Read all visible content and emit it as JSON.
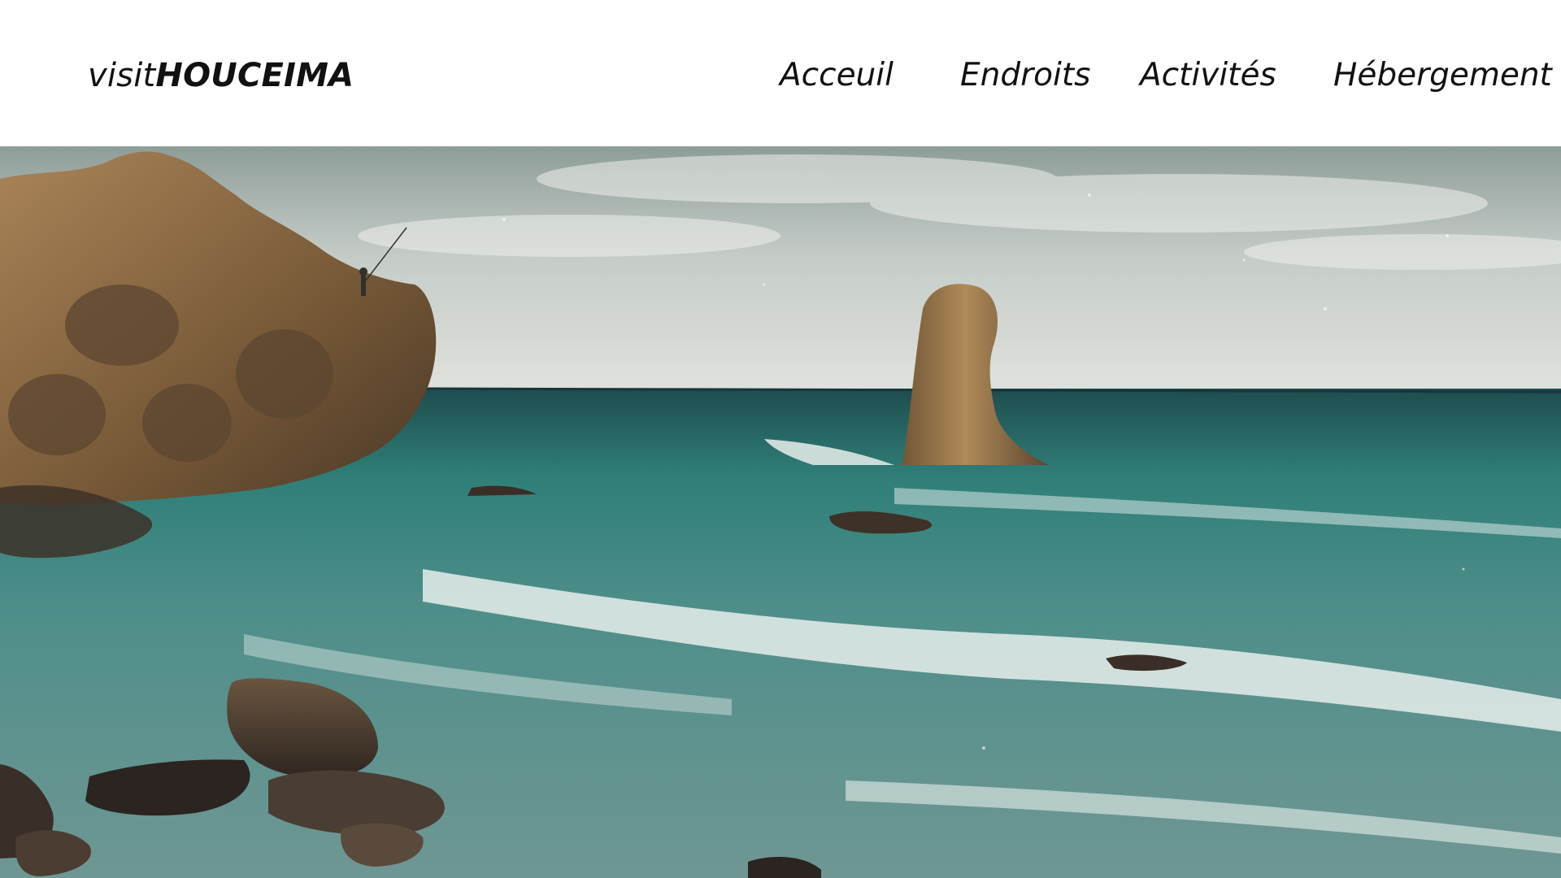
{
  "logo": {
    "prefix": "visit",
    "name": "HOUCEIMA"
  },
  "nav": [
    {
      "label": "Acceuil"
    },
    {
      "label": "Endroits"
    },
    {
      "label": "Activités"
    },
    {
      "label": "Hébergement"
    }
  ],
  "hero": {
    "icon": "coastal-landscape-photo"
  },
  "colors": {
    "text": "#111111",
    "background": "#ffffff",
    "sea": "#3f8a86",
    "rock": "#8a6b45",
    "sky": "#c9d0cc"
  }
}
